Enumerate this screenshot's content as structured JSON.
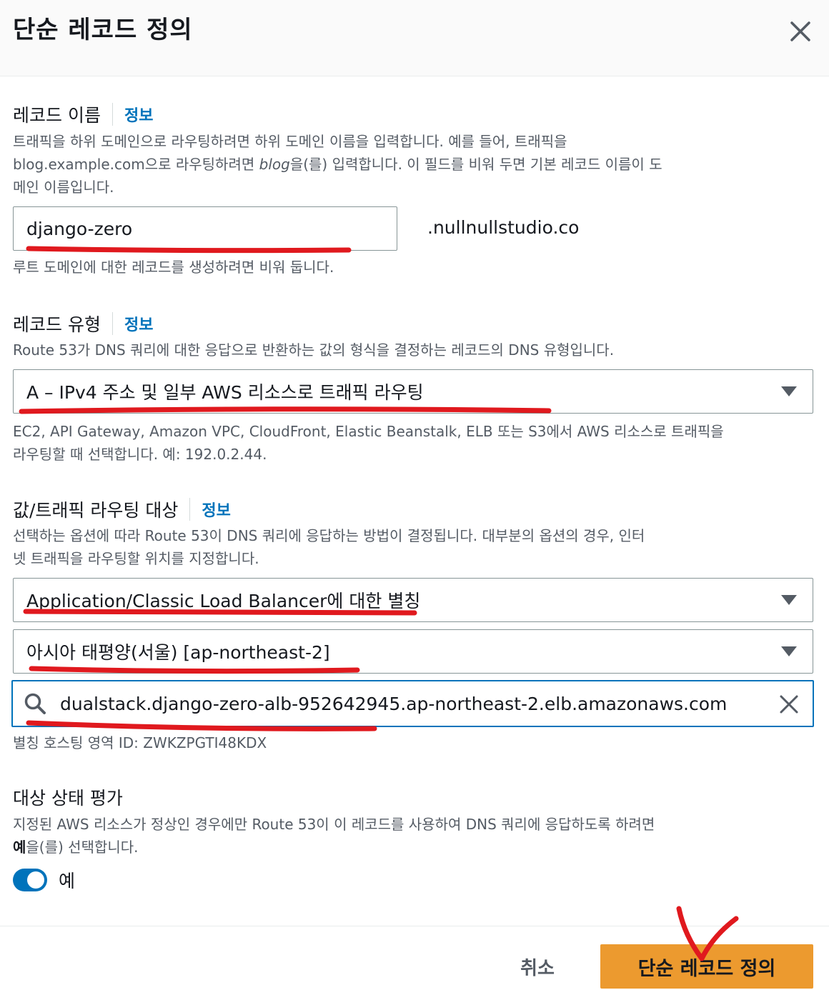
{
  "header": {
    "title": "단순 레코드 정의"
  },
  "record_name": {
    "label": "레코드 이름",
    "info": "정보",
    "desc_1": "트래픽을 하위 도메인으로 라우팅하려면 하위 도메인 이름을 입력합니다. 예를 들어, 트래픽을",
    "desc_2a": "blog.example.com으로 라우팅하려면 ",
    "desc_2b": "blog",
    "desc_2c": "을(를) 입력합니다. 이 필드를 비워 두면 기본 레코드 이름이 도",
    "desc_3": "메인 이름입니다.",
    "value": "django-zero",
    "domain_suffix": ".nullnullstudio.co",
    "hint": "루트 도메인에 대한 레코드를 생성하려면 비워 둡니다."
  },
  "record_type": {
    "label": "레코드 유형",
    "info": "정보",
    "desc": "Route 53가 DNS 쿼리에 대한 응답으로 반환하는 값의 형식을 결정하는 레코드의 DNS 유형입니다.",
    "selected": "A – IPv4 주소 및 일부 AWS 리소스로 트래픽 라우팅",
    "hint_1": "EC2, API Gateway, Amazon VPC, CloudFront, Elastic Beanstalk, ELB 또는 S3에서 AWS 리소스로 트래픽을",
    "hint_2": "라우팅할 때 선택합니다. 예: 192.0.2.44."
  },
  "routing_target": {
    "label": "값/트래픽 라우팅 대상",
    "info": "정보",
    "desc_1": "선택하는 옵션에 따라 Route 53이 DNS 쿼리에 응답하는 방법이 결정됩니다. 대부분의 옵션의 경우, 인터",
    "desc_2": "넷 트래픽을 라우팅할 위치를 지정합니다.",
    "endpoint_selected": "Application/Classic Load Balancer에 대한 별칭",
    "region_selected": "아시아 태평양(서울) [ap-northeast-2]",
    "lb_value": "dualstack.django-zero-alb-952642945.ap-northeast-2.elb.amazonaws.com",
    "hosted_zone": "별칭 호스팅 영역 ID: ZWKZPGTI48KDX"
  },
  "health": {
    "label": "대상 상태 평가",
    "desc_1": "지정된 AWS 리소스가 정상인 경우에만 Route 53이 이 레코드를 사용하여 DNS 쿼리에 응답하도록 하려면",
    "desc_2a": "예",
    "desc_2b": "을(를) 선택합니다.",
    "toggle_label": "예"
  },
  "footer": {
    "cancel": "취소",
    "submit": "단순 레코드 정의"
  },
  "colors": {
    "accent": "#0073bb",
    "primary_button": "#ec9a2f",
    "annotation": "#e0191e"
  }
}
